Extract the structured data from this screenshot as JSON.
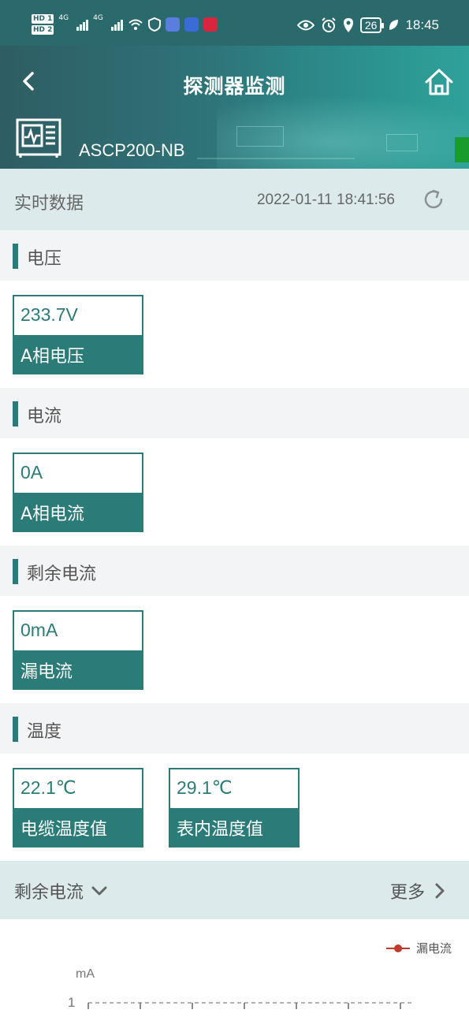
{
  "status_bar": {
    "hd1": "HD 1",
    "hd2": "HD 2",
    "net1": "4G",
    "net2": "4G",
    "battery": "26",
    "time": "18:45"
  },
  "nav": {
    "title": "探测器监测"
  },
  "device": {
    "name": "ASCP200-NB"
  },
  "realtime": {
    "title": "实时数据",
    "timestamp": "2022-01-11 18:41:56"
  },
  "sections": {
    "voltage": {
      "title": "电压",
      "cards": [
        {
          "value": "233.7V",
          "label": "A相电压"
        }
      ]
    },
    "current": {
      "title": "电流",
      "cards": [
        {
          "value": "0A",
          "label": "A相电流"
        }
      ]
    },
    "residual": {
      "title": "剩余电流",
      "cards": [
        {
          "value": "0mA",
          "label": "漏电流"
        }
      ]
    },
    "temperature": {
      "title": "温度",
      "cards": [
        {
          "value": "22.1℃",
          "label": "电缆温度值"
        },
        {
          "value": "29.1℃",
          "label": "表内温度值"
        }
      ]
    }
  },
  "chart_section": {
    "selector": "剩余电流",
    "more": "更多"
  },
  "chart_data": {
    "type": "line",
    "series": [
      {
        "name": "漏电流",
        "values": []
      }
    ],
    "ylabel": "mA",
    "y_ticks": [
      "1"
    ],
    "legend": "top-right",
    "grid": true
  },
  "colors": {
    "accent": "#2b7c79",
    "header_start": "#2e5d63",
    "header_end": "#2fa29a",
    "legend_marker": "#c0392b"
  }
}
